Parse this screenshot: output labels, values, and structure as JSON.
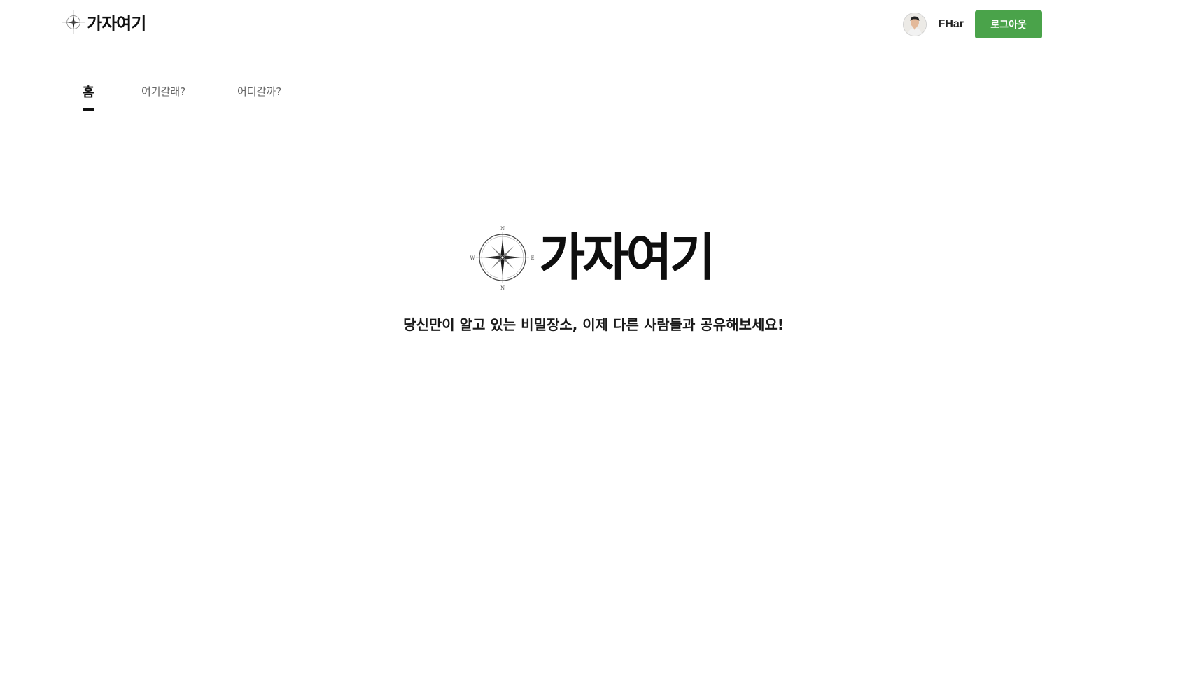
{
  "header": {
    "brand_name": "가자여기",
    "brand_icon": "compass-icon",
    "user": {
      "avatar_icon": "user-avatar-photo",
      "name": "FHar"
    },
    "logout_label": "로그아웃",
    "logout_color": "#4aa34a"
  },
  "tabs": [
    {
      "label": "홈",
      "active": true
    },
    {
      "label": "여기갈래?",
      "active": false
    },
    {
      "label": "어디갈까?",
      "active": false
    }
  ],
  "hero": {
    "logo_icon": "compass-icon",
    "compass_letters": {
      "n": "N",
      "w": "W",
      "e": "E",
      "s": "N"
    },
    "title": "가자여기",
    "tagline": "당신만이 알고 있는 비밀장소, 이제 다른 사람들과 공유해보세요!"
  }
}
